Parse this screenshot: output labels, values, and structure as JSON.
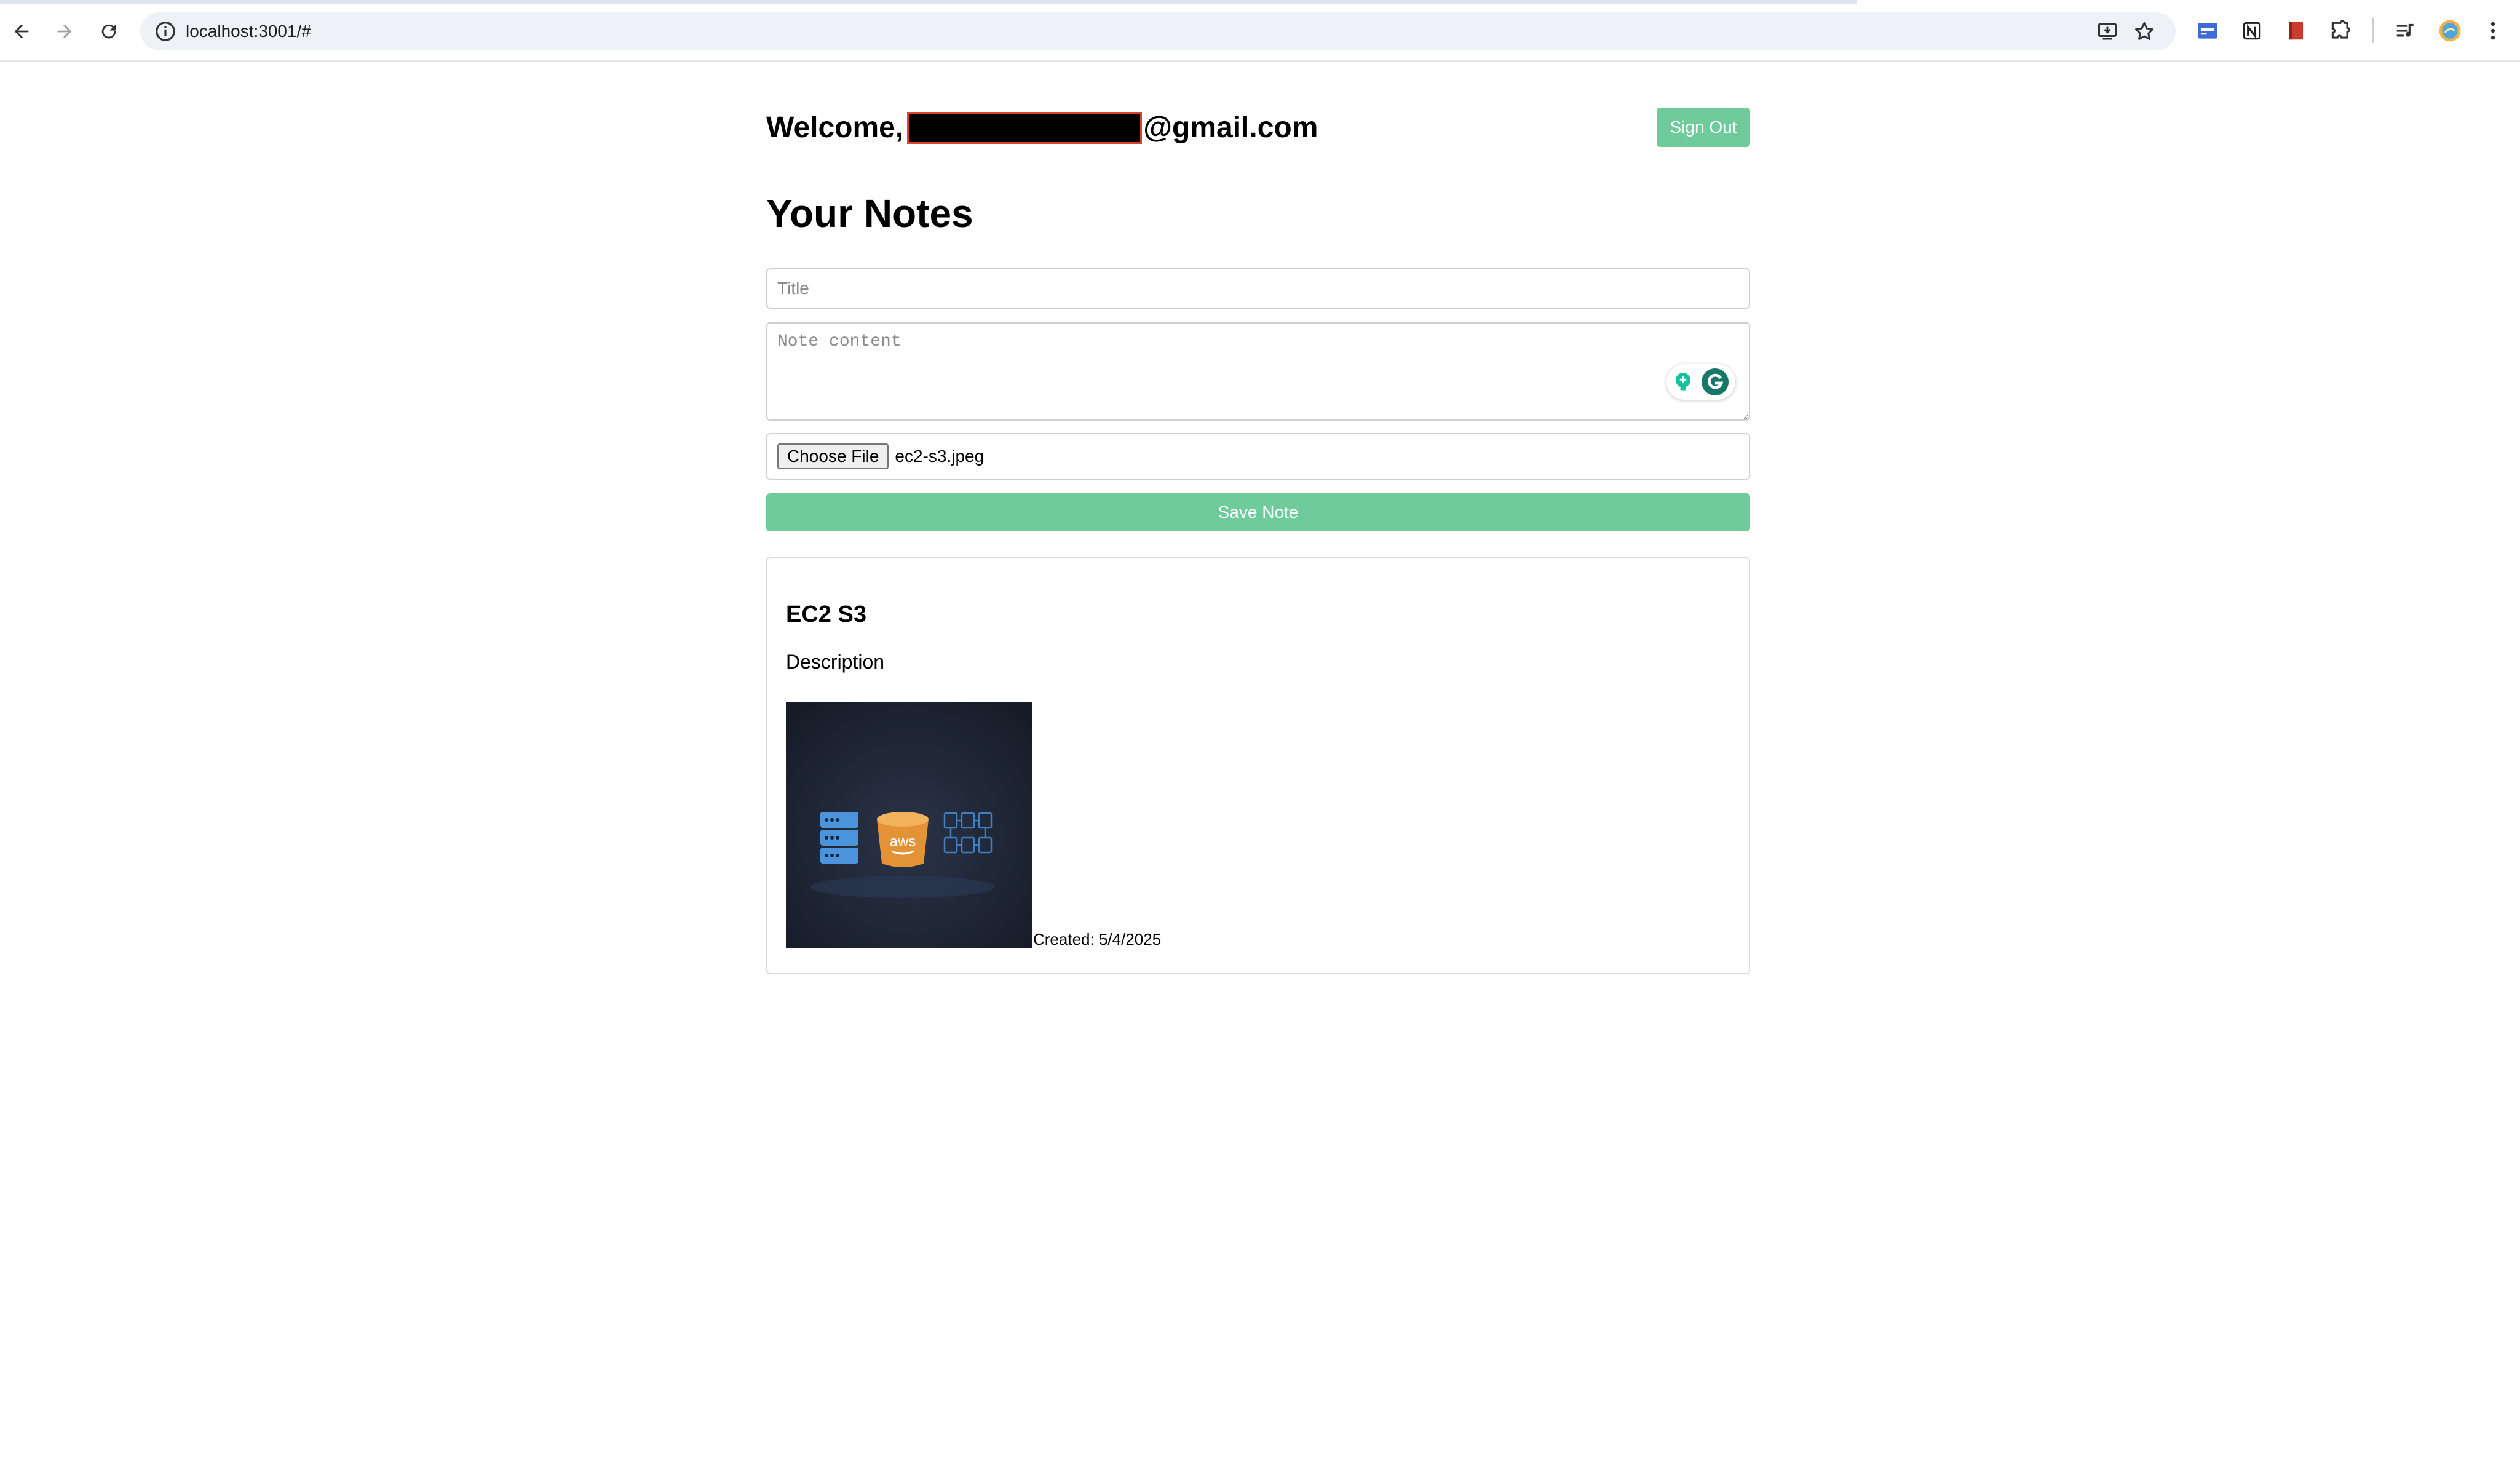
{
  "browser": {
    "url": "localhost:3001/#",
    "icons": {
      "back": "back-arrow-icon",
      "forward": "forward-arrow-icon",
      "reload": "reload-icon",
      "site_info": "info-icon",
      "install": "install-app-icon",
      "bookmark": "star-icon",
      "extensions": [
        "extension-blue-icon",
        "extension-notion-icon",
        "extension-red-book-icon",
        "puzzle-icon"
      ],
      "media": "media-queue-icon",
      "profile": "profile-avatar-icon",
      "menu": "kebab-menu-icon"
    }
  },
  "header": {
    "welcome_prefix": "Welcome,",
    "email_suffix": "@gmail.com",
    "sign_out_label": "Sign Out"
  },
  "main": {
    "title": "Your Notes",
    "title_placeholder": "Title",
    "content_placeholder": "Note content",
    "choose_file_label": "Choose File",
    "chosen_file": "ec2-s3.jpeg",
    "save_label": "Save Note"
  },
  "notes": [
    {
      "title": "EC2 S3",
      "description": "Description",
      "image_text": "aws",
      "created": "Created: 5/4/2025"
    }
  ],
  "colors": {
    "accent": "#6fcb9b",
    "redaction": "#000000",
    "redaction_border": "#d9442a",
    "image_bg": "#1e2533",
    "server_blue": "#4b94db",
    "bucket_orange": "#e39236"
  }
}
